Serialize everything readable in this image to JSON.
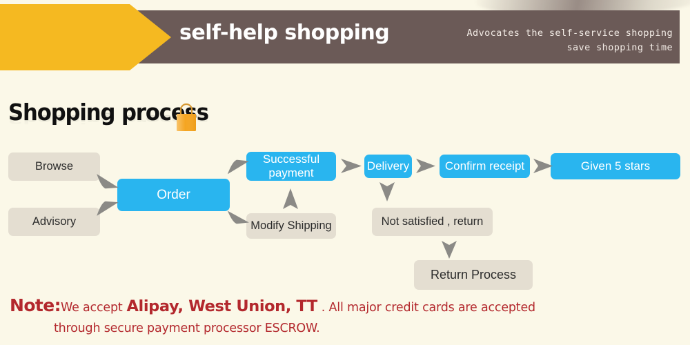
{
  "header": {
    "title": "self-help shopping",
    "tagline_line1": "Advocates the self-service shopping",
    "tagline_line2": "save shopping time",
    "bar_color": "#6b5a57",
    "arrow_color": "#f5b921"
  },
  "section": {
    "title": "Shopping process",
    "bag_icon": "shopping-bag-icon"
  },
  "flow": {
    "nodes": [
      {
        "id": "browse",
        "label": "Browse",
        "style": "beige"
      },
      {
        "id": "advisory",
        "label": "Advisory",
        "style": "beige"
      },
      {
        "id": "order",
        "label": "Order",
        "style": "blue"
      },
      {
        "id": "successful-payment",
        "label": "Successful payment",
        "style": "blue"
      },
      {
        "id": "modify-shipping",
        "label": "Modify Shipping",
        "style": "beige"
      },
      {
        "id": "delivery",
        "label": "Delivery",
        "style": "blue"
      },
      {
        "id": "confirm-receipt",
        "label": "Confirm receipt",
        "style": "blue"
      },
      {
        "id": "given-5-stars",
        "label": "Given 5 stars",
        "style": "blue"
      },
      {
        "id": "not-satisfied",
        "label": "Not satisfied , return",
        "style": "beige"
      },
      {
        "id": "return-process",
        "label": "Return Process",
        "style": "beige"
      }
    ],
    "colors": {
      "beige": "#e4ded1",
      "blue": "#29b5ef",
      "arrow": "#8b8a86"
    }
  },
  "note": {
    "prefix": "Note:",
    "accept_text": "We accept",
    "payment_methods": "Alipay, West Union, TT",
    "line1_tail": ". All major credit cards are accepted",
    "line2": "through secure payment processor ESCROW.",
    "color": "#b3282d"
  }
}
